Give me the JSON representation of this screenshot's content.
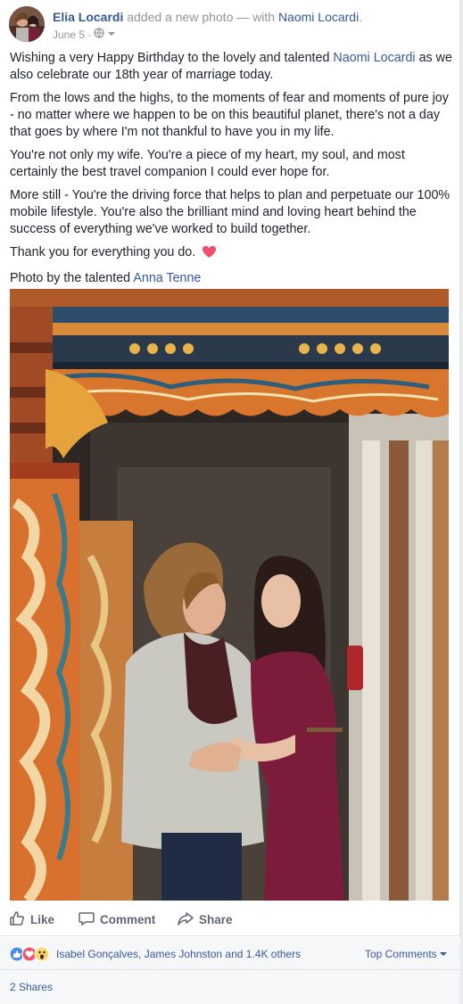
{
  "post": {
    "author": "Elia Locardi",
    "action_text": "added a new photo —",
    "with_word": "with",
    "tagged_person": "Naomi Locardi",
    "tagged_suffix": ".",
    "date": "June 5",
    "meta_sep": "·",
    "privacy_icon": "globe-icon",
    "menu_icon": "chevron-down-icon"
  },
  "body": {
    "p1_prefix": "Wishing a very Happy Birthday to the lovely and talented",
    "p1_link": "Naomi Locardi",
    "p1_suffix": "as we also celebrate our 18th year of marriage today.",
    "p2": "From the lows and the highs, to the moments of fear and moments of pure joy - no matter where we happen to be on this beautiful planet, there's not a day that goes by where I'm not thankful to have you in my life.",
    "p3": "You're not only my wife. You're a piece of my heart, my soul, and most certainly the best travel companion I could ever hope for.",
    "p4": "More still - You're the driving force that helps to plan and perpetuate our 100% mobile lifestyle. You're also the brilliant mind and loving heart behind the success of everything we've worked to build together.",
    "p5": "Thank you for everything you do.",
    "p6_prefix": "Photo by the talented",
    "p6_link": "Anna Tenne"
  },
  "actions": {
    "like": "Like",
    "comment": "Comment",
    "share": "Share"
  },
  "reactions": {
    "icons": [
      "like-icon",
      "love-icon",
      "wow-icon"
    ],
    "names": "Isabel Gonçalves, James Johnston and 1.4K others",
    "sort_label": "Top Comments",
    "shares": "2 Shares"
  },
  "colors": {
    "link": "#365899",
    "muted": "#90949c",
    "action_gray": "#606770",
    "heart": "#f0506e",
    "like_blue": "#4a8af4",
    "love_red": "#f25268",
    "wow_yellow": "#fcd669"
  }
}
